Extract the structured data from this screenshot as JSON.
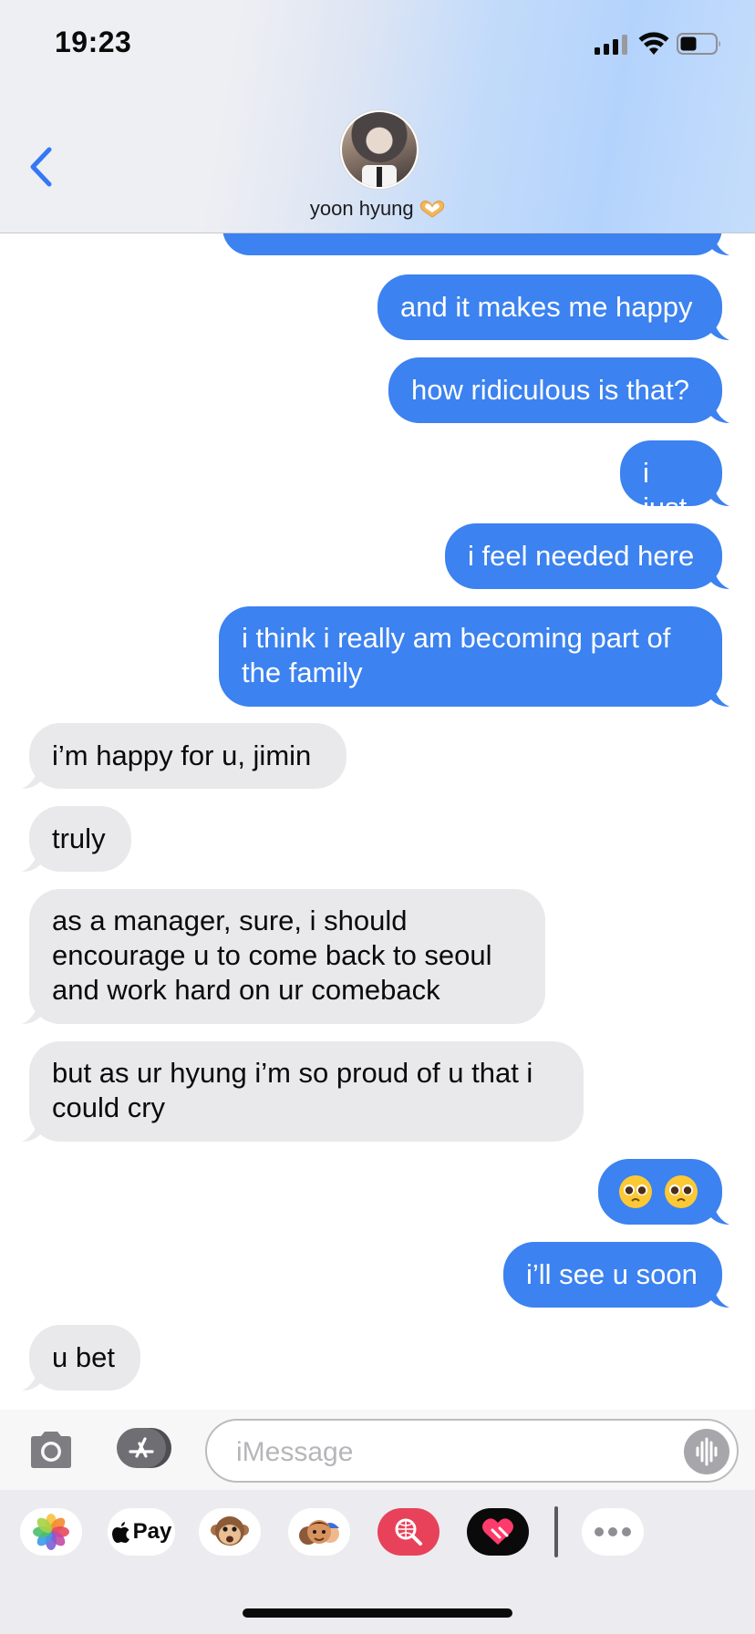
{
  "status_bar": {
    "time": "19:23"
  },
  "header": {
    "contact_name": "yoon hyung",
    "name_emoji": "heart-hands-emoji",
    "back_icon": "chevron-left-icon",
    "accent": "#3478f6"
  },
  "colors": {
    "outgoing_bubble": "#3c82f0",
    "incoming_bubble": "#e9e9eb"
  },
  "messages": [
    {
      "direction": "out",
      "text": "and it makes me happy"
    },
    {
      "direction": "out",
      "text": "how ridiculous is that?"
    },
    {
      "direction": "out",
      "text": "i just"
    },
    {
      "direction": "out",
      "text": "i feel needed here"
    },
    {
      "direction": "out",
      "text": "i think i really am becoming part of the family"
    },
    {
      "direction": "in",
      "text": "i’m happy for u, jimin"
    },
    {
      "direction": "in",
      "text": "truly"
    },
    {
      "direction": "in",
      "text": "as a manager, sure, i should encourage u to come back to seoul and work hard on ur comeback"
    },
    {
      "direction": "in",
      "text": "but as ur hyung i’m so proud of u that i could cry"
    },
    {
      "direction": "out",
      "text": "🥺🥺",
      "emoji": "pleading-face-emoji"
    },
    {
      "direction": "out",
      "text": "i’ll see u soon"
    },
    {
      "direction": "in",
      "text": "u bet"
    }
  ],
  "input_bar": {
    "placeholder": "iMessage",
    "camera_icon": "camera-icon",
    "apps_icon": "app-store-icon",
    "audio_icon": "audio-waveform-icon"
  },
  "app_drawer": {
    "apps": [
      "photos-icon",
      "apple-pay-icon",
      "animoji-icon",
      "memoji-icon",
      "image-search-icon",
      "digital-touch-icon",
      "more-icon"
    ],
    "apple_pay_label": "Pay"
  }
}
